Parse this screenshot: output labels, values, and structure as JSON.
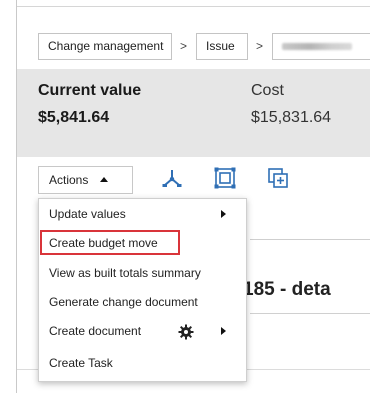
{
  "breadcrumb": {
    "items": [
      "Change management",
      "Issue"
    ],
    "separator": ">"
  },
  "summary": {
    "current_value_label": "Current value",
    "current_value": "$5,841.64",
    "cost_label": "Cost",
    "cost_value": "$15,831.64"
  },
  "toolbar": {
    "actions_label": "Actions",
    "icons": [
      "hierarchy-icon",
      "fit-screen-icon",
      "add-copy-icon"
    ]
  },
  "background": {
    "heading_fragment": "185 - deta"
  },
  "menu": {
    "items": [
      {
        "label": "Update values",
        "has_submenu": true
      },
      {
        "label": "Create budget move",
        "highlighted": true
      },
      {
        "label": "View as built totals summary"
      },
      {
        "label": "Generate change document"
      },
      {
        "label": "Create document",
        "has_submenu": true,
        "icon": "gear-icon"
      },
      {
        "label": "Create Task"
      }
    ],
    "highlight_color": "#d9343a"
  },
  "colors": {
    "summary_bg": "#e6e6e6",
    "icon_blue": "#2f6fb5"
  }
}
